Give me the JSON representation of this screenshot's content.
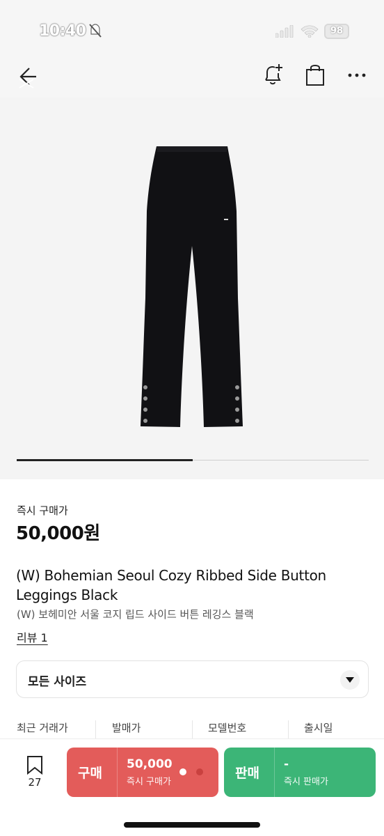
{
  "status_bar": {
    "time": "10:40",
    "battery": "98",
    "icons": [
      "bell-off-icon",
      "signal-icon",
      "wifi-icon",
      "battery-icon"
    ]
  },
  "nav": {
    "icons": [
      "back-icon",
      "bell-plus-icon",
      "shopping-bag-icon",
      "more-icon"
    ]
  },
  "carousel": {
    "progress": 0.5
  },
  "product": {
    "price_label": "즉시 구매가",
    "price": "50,000원",
    "title": "(W) Bohemian Seoul Cozy Ribbed Side Button Leggings Black",
    "subtitle": "(W) 보헤미안 서울 코지 립드 사이드 버튼 레깅스 블랙",
    "review_link": "리뷰 1"
  },
  "size_select": {
    "value": "모든 사이즈"
  },
  "info_columns": [
    "최근 거래가",
    "발매가",
    "모델번호",
    "출시일"
  ],
  "bottom_bar": {
    "bookmark_count": "27",
    "buy": {
      "label": "구매",
      "price": "50,000",
      "sub": "즉시 구매가",
      "color": "#e35c5a"
    },
    "sell": {
      "label": "판매",
      "price": "-",
      "sub": "즉시 판매가",
      "color": "#3cb577"
    }
  }
}
